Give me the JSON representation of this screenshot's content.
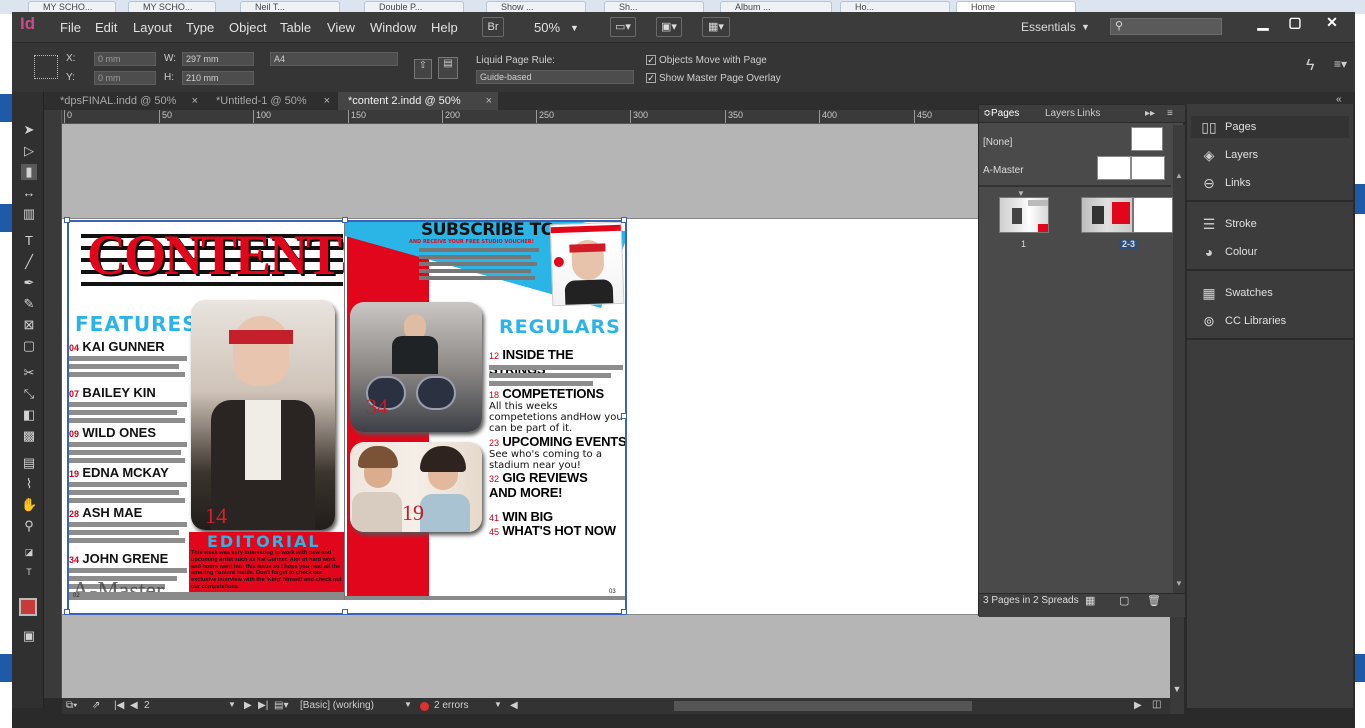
{
  "browser": {
    "tabs": [
      {
        "label": "MY SCHO..."
      },
      {
        "label": "MY SCHO..."
      },
      {
        "label": "Neil T..."
      },
      {
        "label": "Double P..."
      },
      {
        "label": "Show ..."
      },
      {
        "label": "Sh..."
      },
      {
        "label": "Album ..."
      },
      {
        "label": "Ho..."
      },
      {
        "label": "Home"
      }
    ]
  },
  "app": {
    "logo": "Id",
    "menu": [
      "File",
      "Edit",
      "Layout",
      "Type",
      "Object",
      "Table",
      "View",
      "Window",
      "Help"
    ],
    "bridge": "Br",
    "zoom": "50%",
    "workspace": "Essentials",
    "search_placeholder": ""
  },
  "control": {
    "x_label": "X:",
    "x_value": "0 mm",
    "y_label": "Y:",
    "y_value": "0 mm",
    "w_label": "W:",
    "w_value": "297 mm",
    "h_label": "H:",
    "h_value": "210 mm",
    "preset": "A4",
    "liquid_label": "Liquid Page Rule:",
    "liquid_value": "Guide-based",
    "objects_move": "Objects Move with Page",
    "show_master": "Show Master Page Overlay"
  },
  "doc_tabs": [
    {
      "label": "*dpsFINAL.indd @ 50%"
    },
    {
      "label": "*Untitled-1 @ 50%"
    },
    {
      "label": "*content 2.indd @ 50%"
    }
  ],
  "ruler": [
    "0",
    "50",
    "100",
    "150",
    "200",
    "250",
    "300",
    "350",
    "400",
    "450"
  ],
  "spread": {
    "contents_title": "CONTENTS",
    "subscribe_title": "SUBSCRIBE TO",
    "subscribe_sub": "AND RECEIVE YOUR FREE STUDIO VOUCHER!",
    "features_title": "FEATURES",
    "features": [
      {
        "num": "04",
        "name": "KAI GUNNER"
      },
      {
        "num": "07",
        "name": "BAILEY KIN"
      },
      {
        "num": "09",
        "name": "WILD ONES"
      },
      {
        "num": "19",
        "name": "EDNA MCKAY"
      },
      {
        "num": "28",
        "name": "ASH MAE"
      },
      {
        "num": "34",
        "name": "JOHN GRENE"
      }
    ],
    "editorial_title": "EDITORIAL",
    "editorial_text": "This week was very interesting to work with new and upcoming artist such as Kai Gunner. Alot of hard work and hours went into this issue so I hope you read all the amazing content inside. Don't forget to check our exclusive interview with the 'King' himself and check out our competetions.",
    "photo1_num": "14",
    "photo2_num": "34",
    "photo3_num": "19",
    "regulars_title": "REGULARS",
    "regulars": [
      {
        "num": "12",
        "title": "INSIDE THE STRINGS",
        "desc": ""
      },
      {
        "num": "18",
        "title": "COMPETETIONS",
        "desc": "All this weeks competetions andHow you can be part of it."
      },
      {
        "num": "23",
        "title": "UPCOMING EVENTS",
        "desc": "See who's coming to a stadium near you!"
      },
      {
        "num": "32",
        "title": "GIG REVIEWS AND MORE!",
        "desc": ""
      },
      {
        "num": "41",
        "title": "WIN BIG",
        "desc": ""
      },
      {
        "num": "45",
        "title": "WHAT'S HOT NOW",
        "desc": ""
      }
    ],
    "master_overlay": "A-Master",
    "folio_left": "02",
    "folio_right": "03"
  },
  "pages_panel": {
    "tabs": [
      "Pages",
      "Layers",
      "Links"
    ],
    "none": "[None]",
    "master": "A-Master",
    "page1_label": "1",
    "page23_label": "2-3",
    "footer": "3 Pages in 2 Spreads"
  },
  "dock": [
    "Pages",
    "Layers",
    "Links",
    "Stroke",
    "Colour",
    "Swatches",
    "CC Libraries"
  ],
  "status": {
    "page": "2",
    "style": "[Basic] (working)",
    "errors": "2 errors"
  },
  "colors": {
    "accent_red": "#e1061b",
    "accent_cyan": "#2bb5e6",
    "indesign_pink": "#c94a8a"
  }
}
